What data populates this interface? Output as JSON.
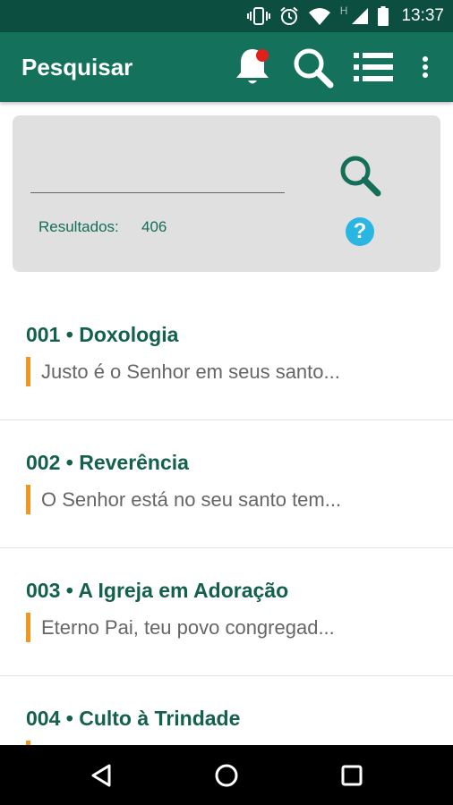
{
  "status_bar": {
    "time": "13:37",
    "network_label": "H",
    "icons": [
      "vibrate-icon",
      "alarm-icon",
      "wifi-icon",
      "signal-icon",
      "battery-icon"
    ]
  },
  "app_bar": {
    "title": "Pesquisar",
    "actions": [
      "notification-bell-icon",
      "search-icon",
      "list-icon",
      "more-vert-icon"
    ]
  },
  "search": {
    "input_value": "",
    "results_label": "Resultados:",
    "results_count": "406",
    "help_label": "?"
  },
  "hymns": [
    {
      "number": "001",
      "title": "Doxologia",
      "heading": "001 • Doxologia",
      "excerpt": "Justo é o Senhor em seus santo..."
    },
    {
      "number": "002",
      "title": "Reverência",
      "heading": "002 • Reverência",
      "excerpt": "O Senhor está no seu santo tem..."
    },
    {
      "number": "003",
      "title": "A Igreja em Adoração",
      "heading": "003 • A Igreja em Adoração",
      "excerpt": "Eterno Pai, teu povo congregad..."
    },
    {
      "number": "004",
      "title": "Culto à Trindade",
      "heading": "004 • Culto à Trindade",
      "excerpt": ""
    }
  ],
  "colors": {
    "status_bar": "#0c4e40",
    "app_bar": "#14725c",
    "title_text": "#12604d",
    "accent_orange": "#f7941e",
    "help_blue": "#29b6e3",
    "notification_dot": "#e0201b"
  },
  "nav_bar": {
    "buttons": [
      "back-icon",
      "home-icon",
      "recents-icon"
    ]
  }
}
